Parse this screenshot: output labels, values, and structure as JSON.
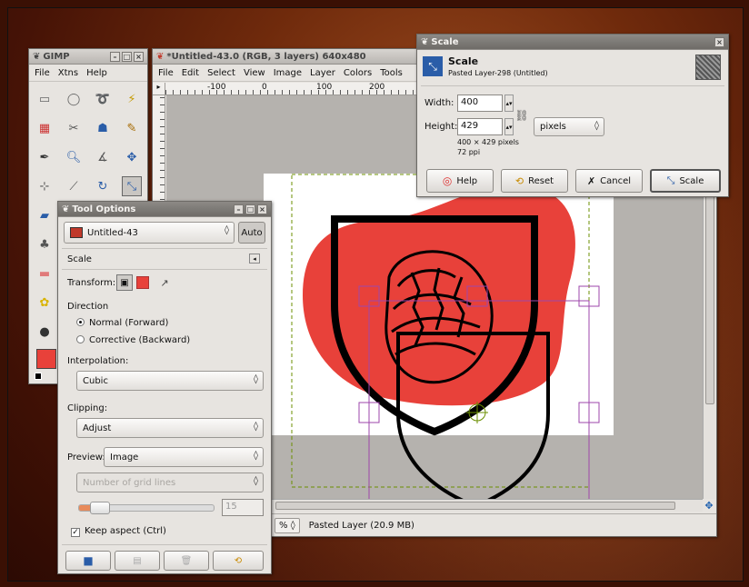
{
  "gimp_toolbox": {
    "title": "GIMP",
    "menu": [
      "File",
      "Xtns",
      "Help"
    ]
  },
  "image_window": {
    "title": "*Untitled-43.0 (RGB, 3 layers) 640x480",
    "menu": [
      "File",
      "Edit",
      "Select",
      "View",
      "Image",
      "Layer",
      "Colors",
      "Tools"
    ],
    "ruler_ticks": [
      "-100",
      "0",
      "100",
      "200"
    ],
    "zoom": "%",
    "status": "Pasted Layer (20.9 MB)"
  },
  "scale_dialog": {
    "window_title": "Scale",
    "heading": "Scale",
    "subtitle": "Pasted Layer-298 (Untitled)",
    "width_label": "Width:",
    "width_value": "400",
    "height_label": "Height:",
    "height_value": "429",
    "size_info": "400 × 429 pixels",
    "resolution": "72 ppi",
    "unit": "pixels",
    "buttons": {
      "help": "Help",
      "reset": "Reset",
      "cancel": "Cancel",
      "scale": "Scale"
    }
  },
  "tool_options": {
    "title": "Tool Options",
    "image_select": "Untitled-43",
    "auto": "Auto",
    "section": "Scale",
    "transform_label": "Transform:",
    "direction_label": "Direction",
    "direction_options": [
      "Normal (Forward)",
      "Corrective (Backward)"
    ],
    "interpolation_label": "Interpolation:",
    "interpolation_value": "Cubic",
    "clipping_label": "Clipping:",
    "clipping_value": "Adjust",
    "preview_label": "Preview:",
    "preview_value": "Image",
    "grid_value": "Number of grid lines",
    "grid_count": "15",
    "keep_aspect": "Keep aspect  (Ctrl)"
  },
  "colors": {
    "accent_red": "#e8413a",
    "selection": "#9e46ab",
    "guide": "#6b8f00"
  }
}
